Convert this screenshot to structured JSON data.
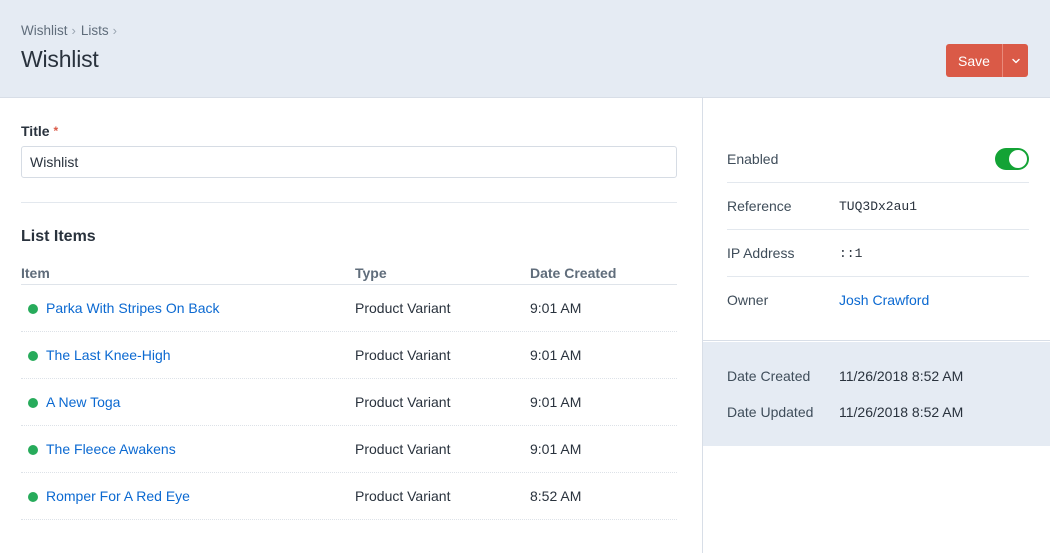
{
  "breadcrumb": [
    "Wishlist",
    "Lists"
  ],
  "page_title": "Wishlist",
  "actions": {
    "save_label": "Save"
  },
  "form": {
    "title_label": "Title",
    "required_marker": "*",
    "title_value": "Wishlist"
  },
  "list_items": {
    "heading": "List Items",
    "columns": [
      "Item",
      "Type",
      "Date Created"
    ],
    "rows": [
      {
        "name": "Parka With Stripes On Back",
        "type": "Product Variant",
        "date": "9:01 AM"
      },
      {
        "name": "The Last Knee-High",
        "type": "Product Variant",
        "date": "9:01 AM"
      },
      {
        "name": "A New Toga",
        "type": "Product Variant",
        "date": "9:01 AM"
      },
      {
        "name": "The Fleece Awakens",
        "type": "Product Variant",
        "date": "9:01 AM"
      },
      {
        "name": "Romper For A Red Eye",
        "type": "Product Variant",
        "date": "8:52 AM"
      }
    ]
  },
  "meta": {
    "enabled_label": "Enabled",
    "enabled": true,
    "reference_label": "Reference",
    "reference_value": "TUQ3Dx2au1",
    "ip_label": "IP Address",
    "ip_value": "::1",
    "owner_label": "Owner",
    "owner_value": "Josh Crawford",
    "date_created_label": "Date Created",
    "date_created_value": "11/26/2018 8:52 AM",
    "date_updated_label": "Date Updated",
    "date_updated_value": "11/26/2018 8:52 AM"
  },
  "colors": {
    "accent": "#da5a47",
    "link": "#0b69d1",
    "status_green": "#27ab5b",
    "toggle_on": "#13a335",
    "header_bg": "#e5ebf3"
  }
}
